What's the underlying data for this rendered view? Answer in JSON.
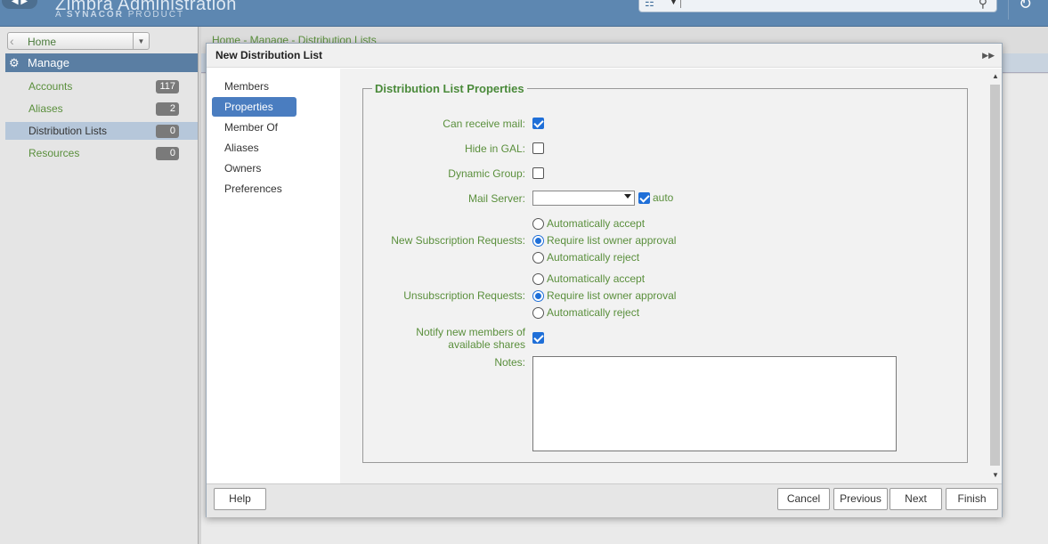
{
  "app": {
    "title": "Zimbra Administration",
    "subtitle_prefix": "A",
    "subtitle_brand": "SYNACOR",
    "subtitle_suffix": "PRODUCT",
    "nav_arrows": "◀ ▶"
  },
  "search": {
    "placeholder": ""
  },
  "sidebar": {
    "home_label": "Home",
    "manage_label": "Manage",
    "items": [
      {
        "label": "Accounts",
        "count": "117"
      },
      {
        "label": "Aliases",
        "count": "2"
      },
      {
        "label": "Distribution Lists",
        "count": "0"
      },
      {
        "label": "Resources",
        "count": "0"
      }
    ]
  },
  "main": {
    "breadcrumb": "Home - Manage - Distribution Lists"
  },
  "dialog": {
    "title": "New Distribution List",
    "nav": [
      "Members",
      "Properties",
      "Member Of",
      "Aliases",
      "Owners",
      "Preferences"
    ],
    "section_title": "Distribution List Properties",
    "fields": {
      "can_receive_mail": {
        "label": "Can receive mail:",
        "checked": true
      },
      "hide_in_gal": {
        "label": "Hide in GAL:",
        "checked": false
      },
      "dynamic_group": {
        "label": "Dynamic Group:",
        "checked": false
      },
      "mail_server": {
        "label": "Mail Server:",
        "value": "",
        "auto_label": "auto",
        "auto_checked": true
      },
      "new_subscription": {
        "label": "New Subscription Requests:",
        "options": [
          "Automatically accept",
          "Require list owner approval",
          "Automatically reject"
        ],
        "selected": "Require list owner approval"
      },
      "unsubscription": {
        "label": "Unsubscription Requests:",
        "options": [
          "Automatically accept",
          "Require list owner approval",
          "Automatically reject"
        ],
        "selected": "Require list owner approval"
      },
      "notify": {
        "label_line1": "Notify new members of",
        "label_line2": "available shares",
        "checked": true
      },
      "notes": {
        "label": "Notes:",
        "value": ""
      }
    },
    "buttons": {
      "help": "Help",
      "cancel": "Cancel",
      "previous": "Previous",
      "next": "Next",
      "finish": "Finish"
    }
  },
  "colors": {
    "accent": "#5d87b1",
    "active_nav": "#4a7dc0",
    "label_green": "#5a8f3c",
    "checkbox_blue": "#1f6fd8"
  }
}
